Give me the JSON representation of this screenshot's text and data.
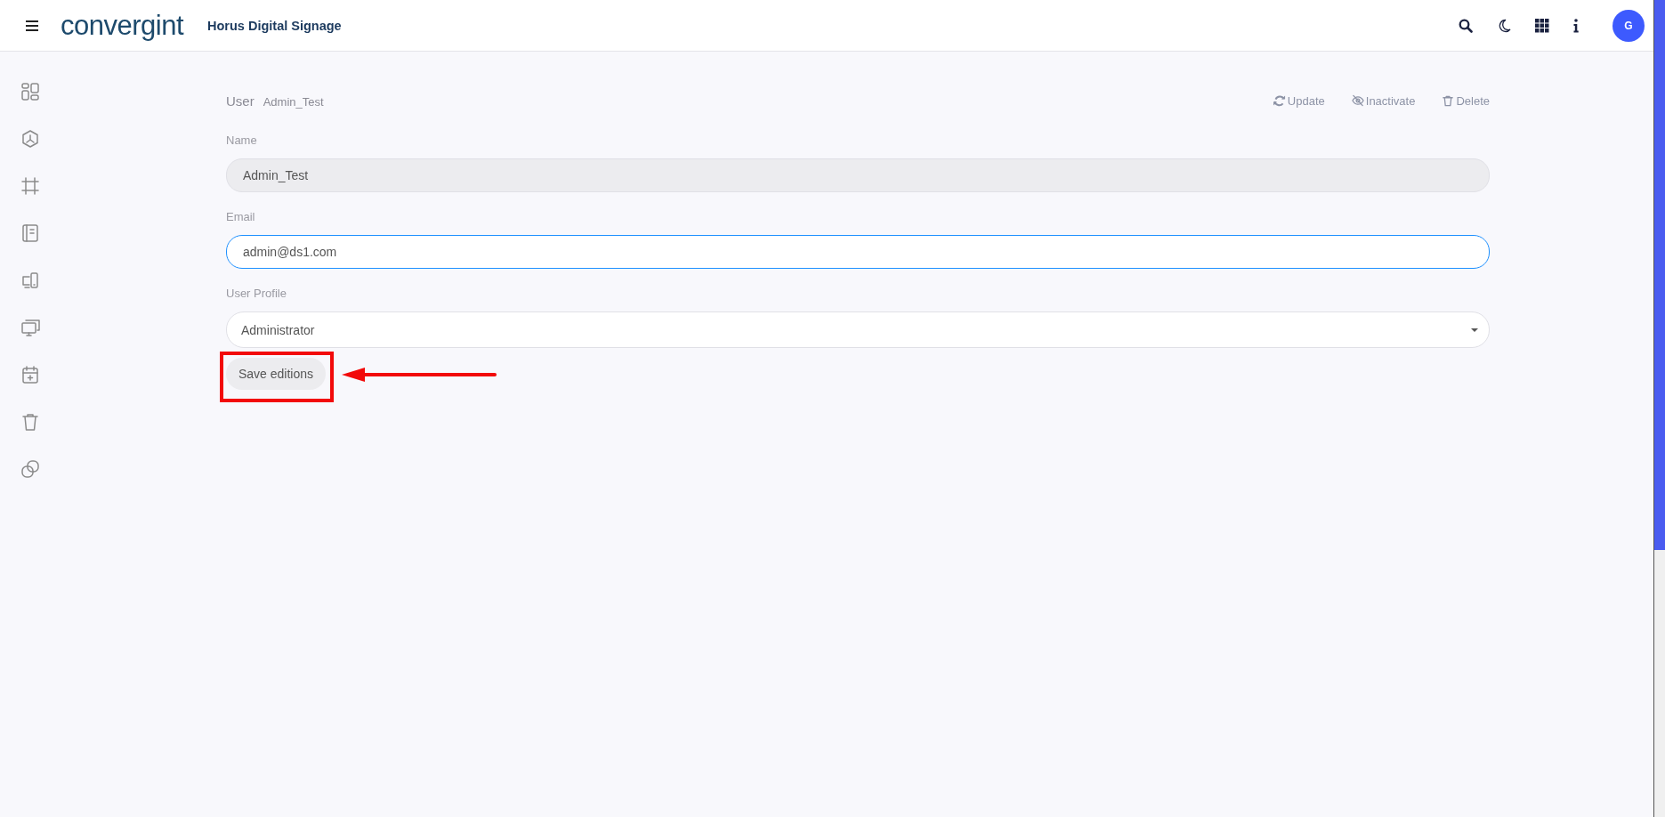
{
  "topbar": {
    "logo": "convergint",
    "app_title": "Horus Digital Signage",
    "avatar": "G"
  },
  "sidebar": {
    "items": [
      {
        "kind": "dashboard"
      },
      {
        "kind": "hexagon"
      },
      {
        "kind": "frame"
      },
      {
        "kind": "notebook"
      },
      {
        "kind": "devices"
      },
      {
        "kind": "screens"
      },
      {
        "kind": "calendar"
      },
      {
        "kind": "trash"
      },
      {
        "kind": "copies"
      }
    ]
  },
  "header": {
    "title": "User",
    "subtitle": "Admin_Test",
    "actions": [
      {
        "kind": "refresh",
        "label": "Update"
      },
      {
        "kind": "eye-off",
        "label": "Inactivate"
      },
      {
        "kind": "trash",
        "label": "Delete"
      }
    ]
  },
  "form": {
    "fields": [
      {
        "kind": "readonly",
        "label": "Name",
        "value": "Admin_Test",
        "focused": false
      },
      {
        "kind": "text",
        "label": "Email",
        "value": "admin@ds1.com",
        "focused": true
      },
      {
        "kind": "select",
        "label": "User Profile",
        "value": "Administrator",
        "focused": false
      }
    ],
    "save_button": "Save editions"
  },
  "annotations": [
    {
      "kind": "box"
    },
    {
      "kind": "arrow"
    }
  ]
}
